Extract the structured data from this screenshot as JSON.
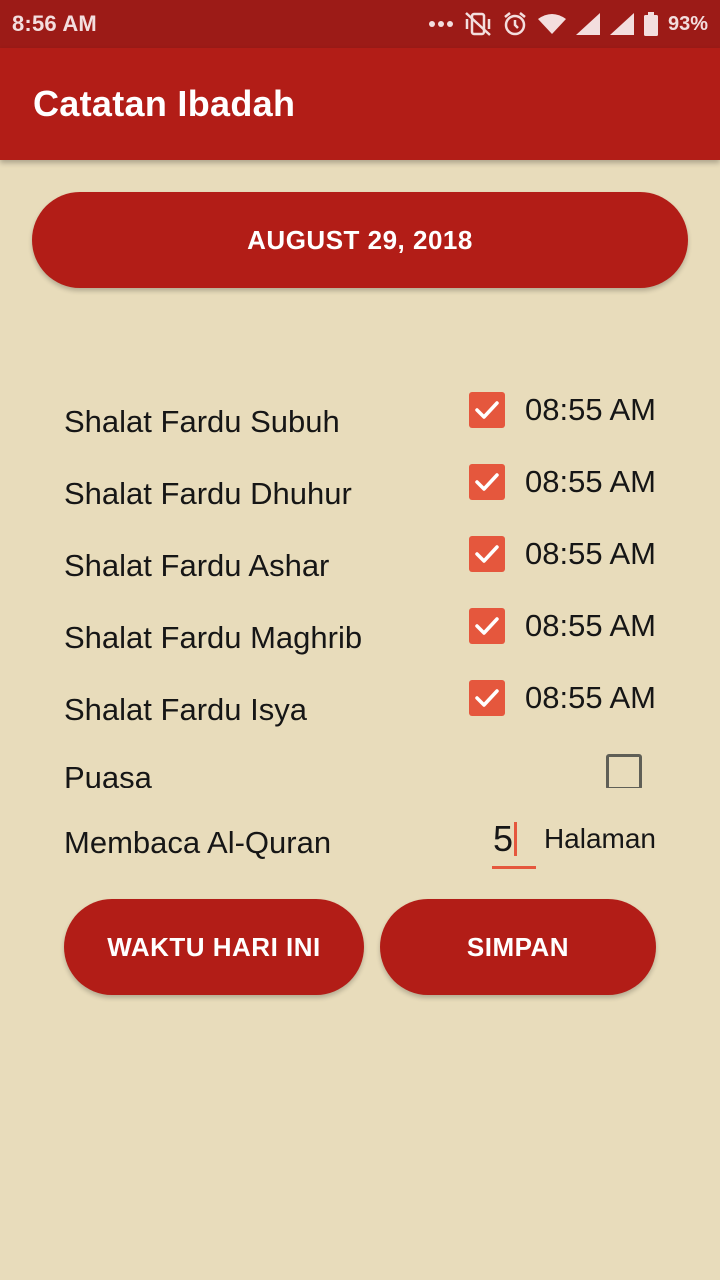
{
  "status_bar": {
    "time": "8:56 AM",
    "battery": "93%",
    "icons": [
      "more-dots-icon",
      "vibrate-off-icon",
      "alarm-icon",
      "wifi-icon",
      "signal-icon",
      "signal-icon",
      "battery-icon"
    ]
  },
  "app_bar": {
    "title": "Catatan Ibadah"
  },
  "date_button": {
    "label": "AUGUST 29, 2018"
  },
  "prayers": [
    {
      "label": "Shalat Fardu Subuh",
      "checked": true,
      "time": "08:55 AM"
    },
    {
      "label": "Shalat Fardu Dhuhur",
      "checked": true,
      "time": "08:55 AM"
    },
    {
      "label": "Shalat Fardu Ashar",
      "checked": true,
      "time": "08:55 AM"
    },
    {
      "label": "Shalat Fardu Maghrib",
      "checked": true,
      "time": "08:55 AM"
    },
    {
      "label": "Shalat Fardu Isya",
      "checked": true,
      "time": "08:55 AM"
    }
  ],
  "puasa": {
    "label": "Puasa",
    "checked": false
  },
  "quran": {
    "label": "Membaca Al-Quran",
    "value": "5",
    "unit": "Halaman"
  },
  "buttons": {
    "today": "WAKTU HARI INI",
    "save": "SIMPAN"
  },
  "colors": {
    "primary": "#b21d17",
    "status_bar": "#9c1b17",
    "accent": "#e5573d",
    "background": "#e8dcbb"
  }
}
